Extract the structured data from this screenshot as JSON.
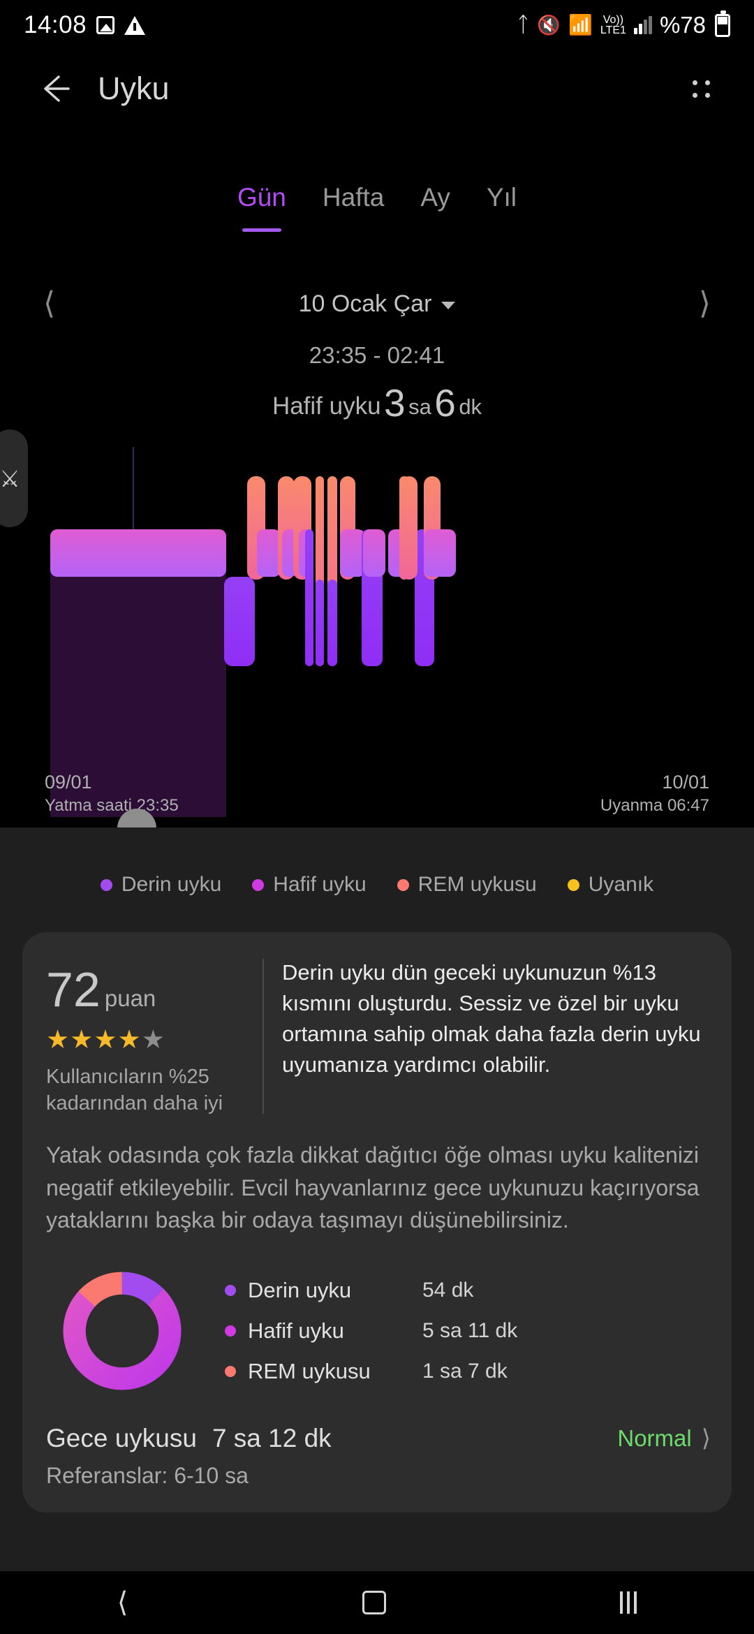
{
  "status_bar": {
    "time": "14:08",
    "icons_left": [
      "image-icon",
      "warning-icon"
    ],
    "icons_right": [
      "bluetooth-icon",
      "mute-icon",
      "wifi-icon",
      "volte-icon",
      "signal-icon"
    ],
    "volte_top": "Vo))",
    "volte_bottom": "LTE1",
    "battery": "%78"
  },
  "app_bar": {
    "title": "Uyku",
    "back_icon": "back-arrow-icon",
    "menu_icon": "more-options-icon"
  },
  "tabs": [
    {
      "label": "Gün",
      "active": true
    },
    {
      "label": "Hafta",
      "active": false
    },
    {
      "label": "Ay",
      "active": false
    },
    {
      "label": "Yıl",
      "active": false
    }
  ],
  "date_nav": {
    "prev_icon": "chevron-left-icon",
    "next_icon": "chevron-right-icon",
    "date": "10 Ocak Çar",
    "dropdown_icon": "caret-down-icon"
  },
  "summary": {
    "time_range": "23:35 - 02:41",
    "stage_label": "Hafif uyku",
    "hours": "3",
    "hours_unit": "sa",
    "minutes": "6",
    "minutes_unit": "dk"
  },
  "accessibility_widget": {
    "icon": "accessibility-icon"
  },
  "chart_axis": {
    "left_date": "09/01",
    "left_label": "Yatma saati 23:35",
    "right_date": "10/01",
    "right_label": "Uyanma 06:47"
  },
  "legend": [
    {
      "label": "Derin uyku",
      "color": "#a24cf0"
    },
    {
      "label": "Hafif uyku",
      "color": "#d13ae0"
    },
    {
      "label": "REM uykusu",
      "color": "#fa7a72"
    },
    {
      "label": "Uyanık",
      "color": "#f5c21f"
    }
  ],
  "score_card": {
    "score": "72",
    "score_unit": "puan",
    "stars_filled": 4,
    "stars_total": 5,
    "comparison": "Kullanıcıların %25 kadarından daha iyi",
    "insight": "Derin uyku dün geceki uykunuzun %13 kısmını oluşturdu. Sessiz ve özel bir uyku ortamına sahip olmak daha fazla derin uyku uyumanıza yardımcı olabilir.",
    "note": "Yatak odasında çok fazla dikkat dağıtıcı öğe olması uyku kalitenizi negatif etkileyebilir. Evcil hayvanlarınız gece uykunuzu kaçırıyorsa yataklarını başka bir odaya taşımayı düşünebilirsiniz."
  },
  "breakdown": [
    {
      "label": "Derin uyku",
      "value": "54 dk",
      "color": "#a24cf0"
    },
    {
      "label": "Hafif uyku",
      "value": "5 sa 11 dk",
      "color": "#d13ae0"
    },
    {
      "label": "REM uykusu",
      "value": "1 sa 7 dk",
      "color": "#fa7a72"
    }
  ],
  "footer": {
    "title": "Gece uykusu",
    "value": "7 sa 12 dk",
    "status": "Normal",
    "status_color": "#6ddc6d",
    "chevron_icon": "chevron-right-icon",
    "reference": "Referanslar: 6-10 sa"
  },
  "nav_bar": {
    "back_icon": "nav-back-icon",
    "home_icon": "nav-home-icon",
    "recents_icon": "nav-recents-icon"
  },
  "chart_data": {
    "type": "area",
    "title": "Uyku evreleri",
    "xlabel": "",
    "ylabel": "",
    "x_start": "23:35",
    "x_end": "06:47",
    "legend_position": "below",
    "grid": false,
    "stage_levels": {
      "REM uykusu": 2,
      "Hafif uyku": 1,
      "Derin uyku": 0
    },
    "colors": {
      "deep": "#a24cf0",
      "light": "#d13ae0",
      "rem": "#fa7a72",
      "awake": "#f5c21f",
      "deep_fill": "#2b0d36"
    },
    "segments": [
      {
        "stage": "Hafif uyku",
        "start_pct": 3.0,
        "end_pct": 43.5
      },
      {
        "stage": "Derin uyku",
        "start_pct": 43.5,
        "end_pct": 50.5
      },
      {
        "stage": "REM uykusu",
        "start_pct": 53.0,
        "end_pct": 55.5
      },
      {
        "stage": "Hafif uyku",
        "start_pct": 55.5,
        "end_pct": 58.5
      },
      {
        "stage": "REM uykusu",
        "start_pct": 59.5,
        "end_pct": 61.5
      },
      {
        "stage": "REM uykusu",
        "start_pct": 62.0,
        "end_pct": 64.5
      },
      {
        "stage": "Hafif uyku",
        "start_pct": 64.5,
        "end_pct": 66.0
      },
      {
        "stage": "Derin uyku",
        "start_pct": 67.0,
        "end_pct": 69.5
      },
      {
        "stage": "REM uykusu",
        "start_pct": 70.5,
        "end_pct": 72.0
      },
      {
        "stage": "REM uykusu",
        "start_pct": 73.0,
        "end_pct": 74.5
      },
      {
        "stage": "Derin uyku",
        "start_pct": 75.5,
        "end_pct": 77.0
      },
      {
        "stage": "Hafif uyku",
        "start_pct": 78.0,
        "end_pct": 82.0
      },
      {
        "stage": "REM uykusu",
        "start_pct": 83.0,
        "end_pct": 84.0
      },
      {
        "stage": "Hafif uyku",
        "start_pct": 84.0,
        "end_pct": 88.0
      },
      {
        "stage": "Derin uyku",
        "start_pct": 88.0,
        "end_pct": 91.0
      },
      {
        "stage": "Hafif uyku",
        "start_pct": 91.0,
        "end_pct": 97.0
      }
    ],
    "donut": {
      "type": "pie",
      "categories": [
        "Derin uyku",
        "Hafif uyku",
        "REM uykusu"
      ],
      "values": [
        54,
        311,
        67
      ],
      "unit": "dk",
      "total_label": "Gece uykusu",
      "total": "7 sa 12 dk"
    }
  }
}
